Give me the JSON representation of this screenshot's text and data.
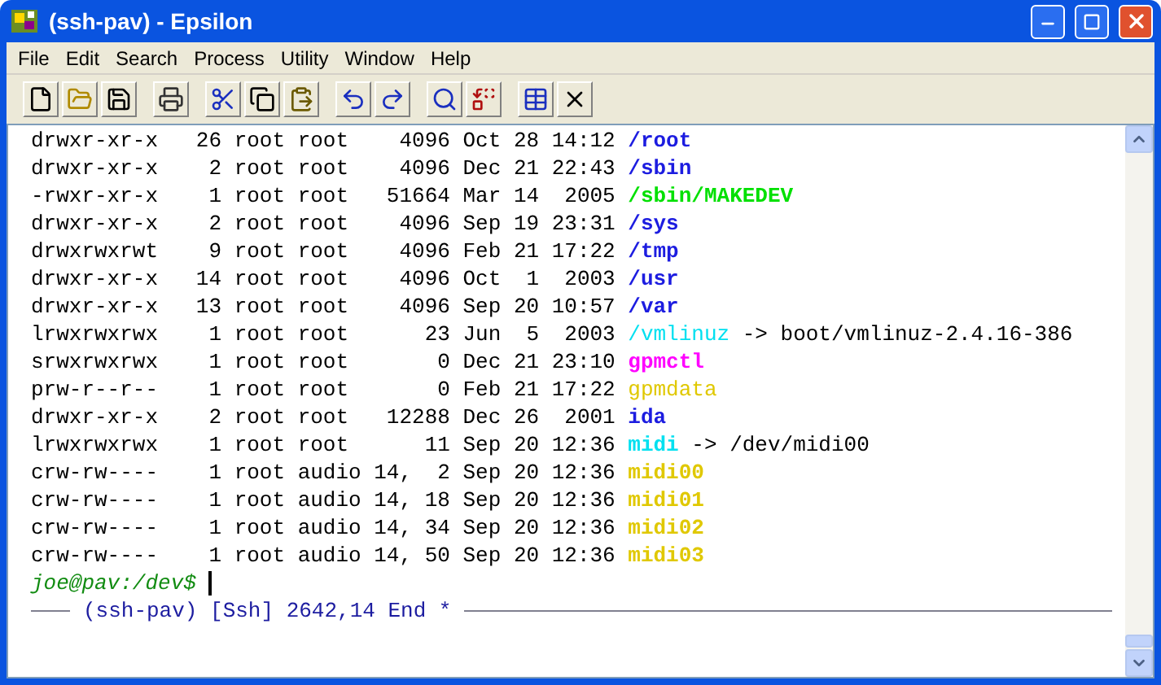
{
  "window": {
    "title": "(ssh-pav) - Epsilon"
  },
  "menu": [
    "File",
    "Edit",
    "Search",
    "Process",
    "Utility",
    "Window",
    "Help"
  ],
  "toolbar": [
    {
      "kind": "new"
    },
    {
      "kind": "open"
    },
    {
      "kind": "save"
    },
    {
      "kind": "print",
      "group_start": true
    },
    {
      "kind": "cut",
      "group_start": true
    },
    {
      "kind": "copy"
    },
    {
      "kind": "paste"
    },
    {
      "kind": "undo",
      "group_start": true
    },
    {
      "kind": "redo"
    },
    {
      "kind": "find",
      "group_start": true
    },
    {
      "kind": "replace"
    },
    {
      "kind": "buffers",
      "group_start": true
    },
    {
      "kind": "close"
    }
  ],
  "listing": [
    {
      "info": "drwxr-xr-x   26 root root    4096 Oct 28 14:12",
      "name": "/root",
      "color": "#1c1ce0",
      "bold": true
    },
    {
      "info": "drwxr-xr-x    2 root root    4096 Dec 21 22:43",
      "name": "/sbin",
      "color": "#1c1ce0",
      "bold": true
    },
    {
      "info": "-rwxr-xr-x    1 root root   51664 Mar 14  2005",
      "name": "/sbin/MAKEDEV",
      "color": "#00e000",
      "bold": true
    },
    {
      "info": "drwxr-xr-x    2 root root    4096 Sep 19 23:31",
      "name": "/sys",
      "color": "#1c1ce0",
      "bold": true
    },
    {
      "info": "drwxrwxrwt    9 root root    4096 Feb 21 17:22",
      "name": "/tmp",
      "color": "#1c1ce0",
      "bold": true
    },
    {
      "info": "drwxr-xr-x   14 root root    4096 Oct  1  2003",
      "name": "/usr",
      "color": "#1c1ce0",
      "bold": true
    },
    {
      "info": "drwxr-xr-x   13 root root    4096 Sep 20 10:57",
      "name": "/var",
      "color": "#1c1ce0",
      "bold": true
    },
    {
      "info": "lrwxrwxrwx    1 root root      23 Jun  5  2003",
      "name": "/vmlinuz",
      "color": "#00e0f0",
      "bold": false,
      "target": "-> boot/vmlinuz-2.4.16-386"
    },
    {
      "info": "srwxrwxrwx    1 root root       0 Dec 21 23:10",
      "name": "gpmctl",
      "color": "#ff00ff",
      "bold": true
    },
    {
      "info": "prw-r--r--    1 root root       0 Feb 21 17:22",
      "name": "gpmdata",
      "color": "#e0c800",
      "bold": false
    },
    {
      "info": "drwxr-xr-x    2 root root   12288 Dec 26  2001",
      "name": "ida",
      "color": "#1c1ce0",
      "bold": true
    },
    {
      "info": "lrwxrwxrwx    1 root root      11 Sep 20 12:36",
      "name": "midi",
      "color": "#00e0f0",
      "bold": true,
      "target": "-> /dev/midi00"
    },
    {
      "info": "crw-rw----    1 root audio 14,  2 Sep 20 12:36",
      "name": "midi00",
      "color": "#e0c800",
      "bold": true
    },
    {
      "info": "crw-rw----    1 root audio 14, 18 Sep 20 12:36",
      "name": "midi01",
      "color": "#e0c800",
      "bold": true
    },
    {
      "info": "crw-rw----    1 root audio 14, 34 Sep 20 12:36",
      "name": "midi02",
      "color": "#e0c800",
      "bold": true
    },
    {
      "info": "crw-rw----    1 root audio 14, 50 Sep 20 12:36",
      "name": "midi03",
      "color": "#e0c800",
      "bold": true
    }
  ],
  "prompt": "joe@pav:/dev$",
  "mode_line": "(ssh-pav) [Ssh] 2642,14 End *"
}
